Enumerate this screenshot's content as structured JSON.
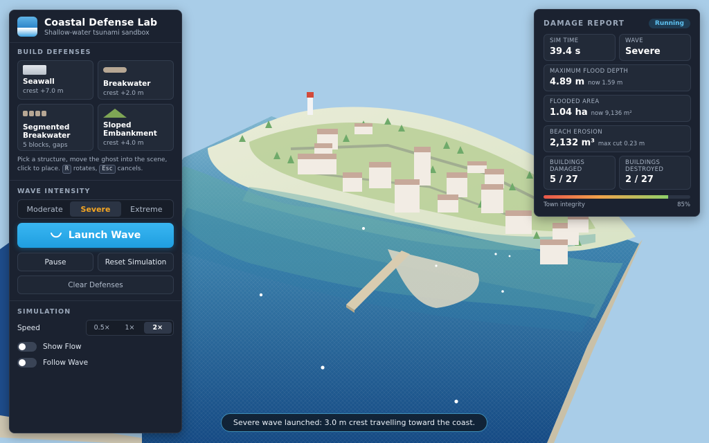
{
  "app": {
    "title": "Coastal Defense Lab",
    "subtitle": "Shallow-water tsunami sandbox"
  },
  "build": {
    "section_label": "BUILD DEFENSES",
    "defenses": [
      {
        "name": "Seawall",
        "detail": "crest +7.0 m"
      },
      {
        "name": "Breakwater",
        "detail": "crest +2.0 m"
      },
      {
        "name": "Segmented Breakwater",
        "detail": "5 blocks, gaps"
      },
      {
        "name": "Sloped Embankment",
        "detail": "crest +4.0 m"
      }
    ],
    "hint_part1": "Pick a structure, move the ghost into the scene, click to place.",
    "hint_key_rotate": "R",
    "hint_part2": "rotates,",
    "hint_key_cancel": "Esc",
    "hint_part3": "cancels."
  },
  "wave": {
    "section_label": "WAVE INTENSITY",
    "options": [
      "Moderate",
      "Severe",
      "Extreme"
    ],
    "selected": "Severe",
    "launch_label": "Launch Wave",
    "pause_label": "Pause",
    "reset_label": "Reset Simulation",
    "clear_label": "Clear Defenses"
  },
  "simulation": {
    "section_label": "SIMULATION",
    "speed_label": "Speed",
    "speed_options": [
      "0.5×",
      "1×",
      "2×"
    ],
    "speed_selected": "2×",
    "show_flow_label": "Show Flow",
    "show_flow_on": false,
    "follow_wave_label": "Follow Wave",
    "follow_wave_on": false
  },
  "report": {
    "title": "DAMAGE REPORT",
    "status": "Running",
    "sim_time_label": "SIM TIME",
    "sim_time_value": "39.4 s",
    "wave_label": "WAVE",
    "wave_value": "Severe",
    "flood_depth_label": "MAXIMUM FLOOD DEPTH",
    "flood_depth_value": "4.89 m",
    "flood_depth_now": "now 1.59 m",
    "flooded_area_label": "FLOODED AREA",
    "flooded_area_value": "1.04 ha",
    "flooded_area_now": "now 9,136 m²",
    "erosion_label": "BEACH EROSION",
    "erosion_value": "2,132 m³",
    "erosion_max": "max cut 0.23 m",
    "damaged_label": "BUILDINGS DAMAGED",
    "damaged_value": "5 / 27",
    "destroyed_label": "BUILDINGS DESTROYED",
    "destroyed_value": "2 / 27",
    "integrity_label": "Town integrity",
    "integrity_text": "85%",
    "integrity_fraction": 0.85
  },
  "toast": {
    "message": "Severe wave launched: 3.0 m crest travelling toward the coast."
  },
  "colors": {
    "accent": "#1f9ee0",
    "selected_wave": "#f5a623",
    "panel_bg": "#1b2230",
    "sky": "#a9cde8"
  }
}
